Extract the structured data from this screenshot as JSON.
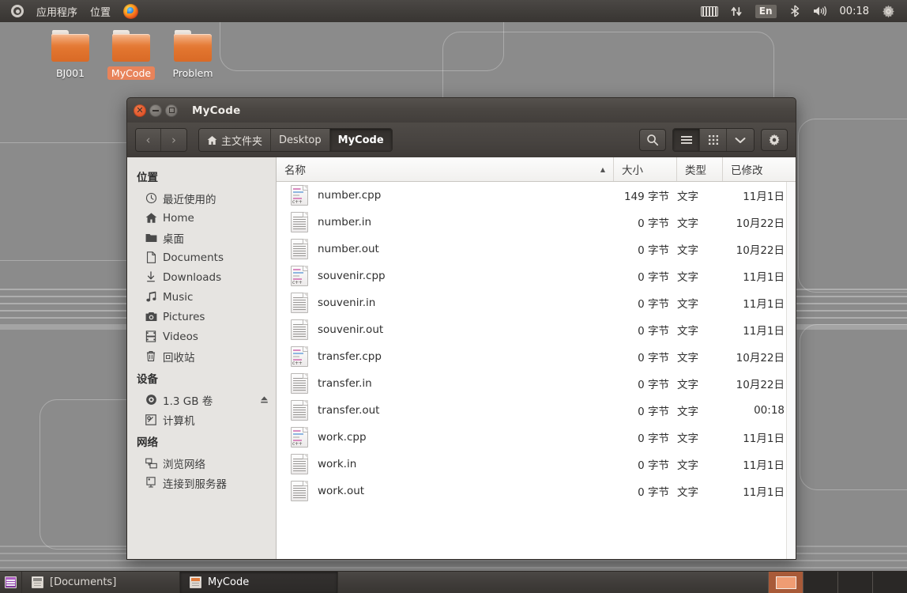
{
  "top_panel": {
    "logo_icon": "ubuntu-logo-icon",
    "menus": [
      "应用程序",
      "位置"
    ],
    "firefox_icon": "firefox-icon",
    "tray": {
      "keyboard_icon": "keyboard-icon",
      "network_icon": "network-updown-icon",
      "language": "En",
      "bluetooth_icon": "bluetooth-icon",
      "volume_icon": "volume-icon",
      "clock": "00:18",
      "settings_icon": "gear-icon"
    }
  },
  "desktop": {
    "icons": [
      {
        "label": "BJ001",
        "selected": false
      },
      {
        "label": "MyCode",
        "selected": true
      },
      {
        "label": "Problem",
        "selected": false
      }
    ]
  },
  "window": {
    "title": "MyCode",
    "controls": {
      "close": "×",
      "minimize": "–",
      "maximize": "□"
    },
    "toolbar": {
      "back_icon": "chevron-left-icon",
      "forward_icon": "chevron-right-icon",
      "breadcrumbs": [
        {
          "label": "主文件夹",
          "icon": "home-icon",
          "active": false
        },
        {
          "label": "Desktop",
          "active": false
        },
        {
          "label": "MyCode",
          "active": true
        }
      ],
      "search_icon": "search-icon",
      "list_view_icon": "list-view-icon",
      "icon_view_icon": "icon-view-icon",
      "view_options_icon": "chevron-down-icon",
      "settings_icon": "gear-icon"
    }
  },
  "sidebar": {
    "sections": [
      {
        "title": "位置",
        "items": [
          {
            "label": "最近使用的",
            "icon": "clock-icon"
          },
          {
            "label": "Home",
            "icon": "home-icon"
          },
          {
            "label": "桌面",
            "icon": "folder-icon"
          },
          {
            "label": "Documents",
            "icon": "document-icon"
          },
          {
            "label": "Downloads",
            "icon": "download-icon"
          },
          {
            "label": "Music",
            "icon": "music-note-icon"
          },
          {
            "label": "Pictures",
            "icon": "camera-icon"
          },
          {
            "label": "Videos",
            "icon": "film-icon"
          },
          {
            "label": "回收站",
            "icon": "trash-icon"
          }
        ]
      },
      {
        "title": "设备",
        "items": [
          {
            "label": "1.3 GB 卷",
            "icon": "disc-icon",
            "eject": true
          },
          {
            "label": "计算机",
            "icon": "computer-icon"
          }
        ]
      },
      {
        "title": "网络",
        "items": [
          {
            "label": "浏览网络",
            "icon": "network-browse-icon"
          },
          {
            "label": "连接到服务器",
            "icon": "server-connect-icon"
          }
        ]
      }
    ]
  },
  "file_list": {
    "columns": [
      {
        "label": "名称",
        "sorted": "asc"
      },
      {
        "label": "大小"
      },
      {
        "label": "类型"
      },
      {
        "label": "已修改"
      }
    ],
    "rows": [
      {
        "name": "number.cpp",
        "size": "149 字节",
        "type": "文字",
        "modified": "11月1日",
        "icon": "cpp-file-icon"
      },
      {
        "name": "number.in",
        "size": "0 字节",
        "type": "文字",
        "modified": "10月22日",
        "icon": "text-file-icon"
      },
      {
        "name": "number.out",
        "size": "0 字节",
        "type": "文字",
        "modified": "10月22日",
        "icon": "text-file-icon"
      },
      {
        "name": "souvenir.cpp",
        "size": "0 字节",
        "type": "文字",
        "modified": "11月1日",
        "icon": "cpp-file-icon"
      },
      {
        "name": "souvenir.in",
        "size": "0 字节",
        "type": "文字",
        "modified": "11月1日",
        "icon": "text-file-icon"
      },
      {
        "name": "souvenir.out",
        "size": "0 字节",
        "type": "文字",
        "modified": "11月1日",
        "icon": "text-file-icon"
      },
      {
        "name": "transfer.cpp",
        "size": "0 字节",
        "type": "文字",
        "modified": "10月22日",
        "icon": "cpp-file-icon"
      },
      {
        "name": "transfer.in",
        "size": "0 字节",
        "type": "文字",
        "modified": "10月22日",
        "icon": "text-file-icon"
      },
      {
        "name": "transfer.out",
        "size": "0 字节",
        "type": "文字",
        "modified": "00:18",
        "icon": "text-file-icon"
      },
      {
        "name": "work.cpp",
        "size": "0 字节",
        "type": "文字",
        "modified": "11月1日",
        "icon": "cpp-file-icon"
      },
      {
        "name": "work.in",
        "size": "0 字节",
        "type": "文字",
        "modified": "11月1日",
        "icon": "text-file-icon"
      },
      {
        "name": "work.out",
        "size": "0 字节",
        "type": "文字",
        "modified": "11月1日",
        "icon": "text-file-icon"
      }
    ]
  },
  "taskbar": {
    "show_desktop_icon": "show-desktop-icon",
    "tasks": [
      {
        "label": "[Documents]",
        "active": false
      },
      {
        "label": "MyCode",
        "active": true
      }
    ],
    "workspaces": [
      {
        "active": true
      },
      {
        "active": false
      },
      {
        "active": false
      },
      {
        "active": false
      }
    ]
  },
  "colors": {
    "panel_bg": "#403d3a",
    "accent_orange": "#e8835a",
    "desktop_bg": "#8b8b8b",
    "sidebar_bg": "#e6e4e1",
    "selected_task": "#2c2a28"
  }
}
